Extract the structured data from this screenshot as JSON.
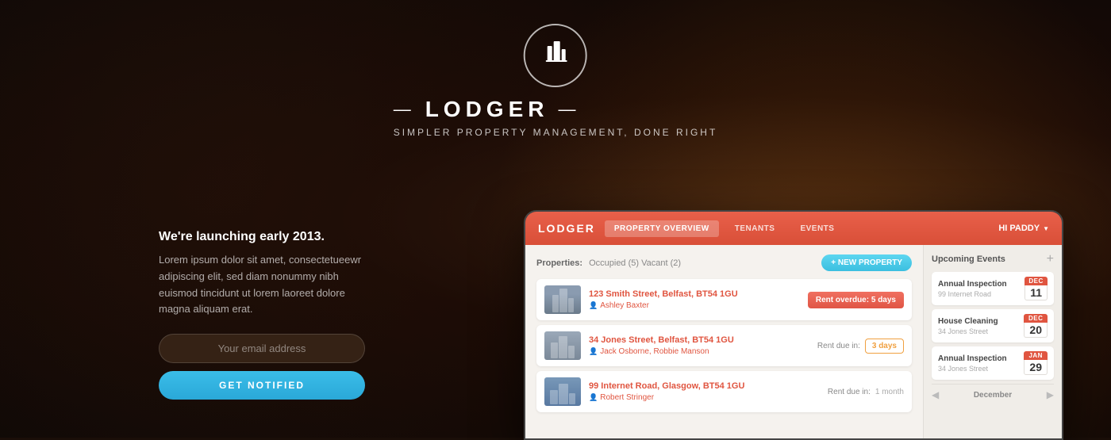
{
  "background": {
    "color": "#1a0e08"
  },
  "logo": {
    "icon": "🏢",
    "dash_left": "—",
    "name": "LODGER",
    "dash_right": "—",
    "subtitle": "SIMPLER PROPERTY MANAGEMENT, DONE RIGHT"
  },
  "left_panel": {
    "heading": "We're launching early 2013.",
    "body": "Lorem ipsum dolor sit amet, consectetueewr adipiscing elit, sed diam nonummy nibh euismod tincidunt ut lorem laoreet dolore magna aliquam erat.",
    "email_placeholder": "Your email address",
    "notify_button": "GET NOTIFIED"
  },
  "app": {
    "header": {
      "logo": "LODGER",
      "nav": [
        {
          "label": "PROPERTY OVERVIEW",
          "active": true
        },
        {
          "label": "TENANTS",
          "active": false
        },
        {
          "label": "EVENTS",
          "active": false
        }
      ],
      "user": "HI PADDY"
    },
    "properties_bar": {
      "label": "Properties:",
      "filters": "Occupied (5)   Vacant (2)",
      "new_button": "+ NEW PROPERTY"
    },
    "properties": [
      {
        "address": "123 Smith Street, Belfast, BT54 1GU",
        "tenant": "Ashley Baxter",
        "status_type": "overdue",
        "status_label": "Rent overdue: 5 days",
        "building_style": "1"
      },
      {
        "address": "34 Jones Street, Belfast, BT54 1GU",
        "tenant": "Jack Osborne, Robbie Manson",
        "status_type": "due",
        "status_label": "3 days",
        "due_prefix": "Rent due in:",
        "building_style": "2"
      },
      {
        "address": "99 Internet Road, Glasgow, BT54 1GU",
        "tenant": "Robert Stringer",
        "status_type": "month",
        "status_label": "1 month",
        "due_prefix": "Rent due in:",
        "building_style": "3"
      }
    ],
    "sidebar": {
      "title": "Upcoming Events",
      "events": [
        {
          "title": "Annual Inspection",
          "sub": "99 Internet Road",
          "month": "DEC",
          "day": "11"
        },
        {
          "title": "House Cleaning",
          "sub": "34 Jones Street",
          "month": "DEC",
          "day": "20"
        },
        {
          "title": "Annual Inspection",
          "sub": "34 Jones Street",
          "month": "JAN",
          "day": "29"
        }
      ],
      "calendar_month": "December",
      "prev_arrow": "◀",
      "next_arrow": "▶"
    }
  }
}
